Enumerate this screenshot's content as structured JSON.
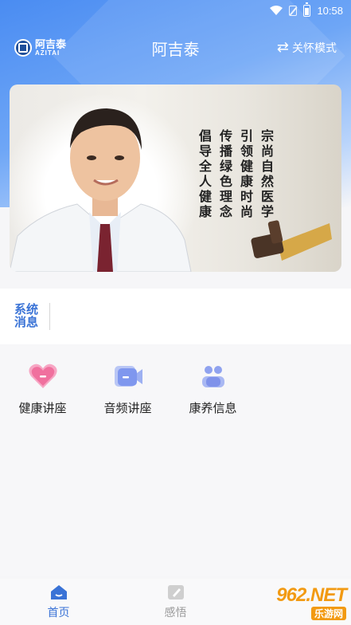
{
  "status_bar": {
    "time": "10:58"
  },
  "header": {
    "logo_cn": "阿吉泰",
    "logo_en": "AZITAI",
    "title": "阿吉泰",
    "care_mode_label": "关怀模式"
  },
  "banner": {
    "calligraphy_columns": [
      "宗尚自然医学",
      "引领健康时尚",
      "传播绿色理念",
      "倡导全人健康"
    ]
  },
  "notice": {
    "label_line1": "系统",
    "label_line2": "消息"
  },
  "menu": {
    "items": [
      {
        "label": "健康讲座",
        "icon": "heart-icon"
      },
      {
        "label": "音频讲座",
        "icon": "video-icon"
      },
      {
        "label": "康养信息",
        "icon": "people-icon"
      }
    ]
  },
  "tabbar": {
    "tabs": [
      {
        "label": "首页",
        "active": true
      },
      {
        "label": "感悟",
        "active": false
      }
    ]
  },
  "watermark": {
    "brand": "962.NET",
    "site": "乐游网"
  },
  "colors": {
    "primary": "#3a73d6",
    "header_gradient": "#4a8cf2",
    "accent_orange": "#f29a12"
  }
}
